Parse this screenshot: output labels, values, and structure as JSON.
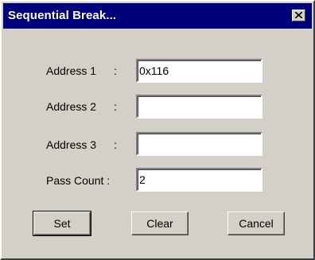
{
  "window": {
    "title": "Sequential Break...",
    "close_icon": "close-icon"
  },
  "form": {
    "fields": [
      {
        "label": "Address 1",
        "separator": ":",
        "value": "0x116"
      },
      {
        "label": "Address 2",
        "separator": ":",
        "value": ""
      },
      {
        "label": "Address 3",
        "separator": ":",
        "value": ""
      },
      {
        "label": "Pass Count :",
        "separator": "",
        "value": "2"
      }
    ]
  },
  "buttons": {
    "set": "Set",
    "clear": "Clear",
    "cancel": "Cancel"
  }
}
